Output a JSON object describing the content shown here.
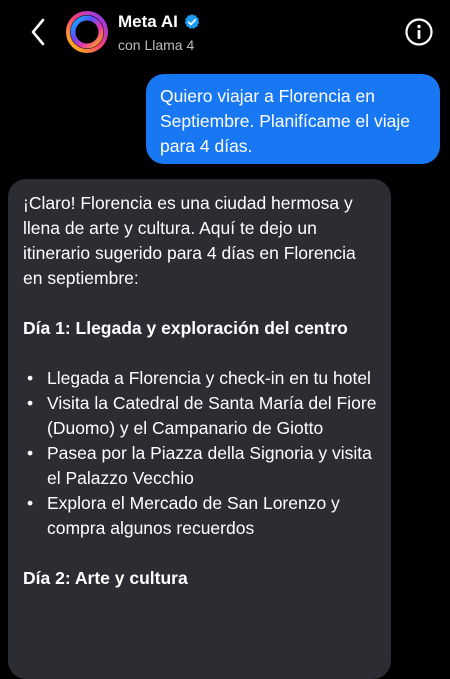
{
  "header": {
    "title": "Meta AI",
    "subtitle": "con Llama 4",
    "icons": {
      "back": "chevron-left-icon",
      "avatar": "meta-ai-ring-icon",
      "verified": "verified-badge-icon",
      "info": "info-icon"
    },
    "colors": {
      "verified": "#1d9bf0"
    }
  },
  "messages": {
    "user": {
      "text": "Quiero viajar a Florencia en Septiembre. Planifícame el viaje para 4 días."
    },
    "ai": {
      "intro": "¡Claro! Florencia es una ciudad hermosa y llena de arte y cultura. Aquí te dejo un itinerario sugerido para 4 días en Florencia en septiembre:",
      "day1_heading": "Día 1: Llegada y exploración del centro",
      "day1_items": [
        "Llegada a Florencia y check-in en tu hotel",
        "Visita la Catedral de Santa María del Fiore (Duomo) y el Campanario de Giotto",
        "Pasea por la Piazza della Signoria y visita el Palazzo Vecchio",
        "Explora el Mercado de San Lorenzo y compra algunos recuerdos"
      ],
      "day2_heading": "Día 2: Arte y cultura"
    }
  },
  "colors": {
    "background": "#000000",
    "user_bubble": "#1877f2",
    "ai_bubble": "#2b2d33",
    "subtitle": "#b9bcc3"
  }
}
